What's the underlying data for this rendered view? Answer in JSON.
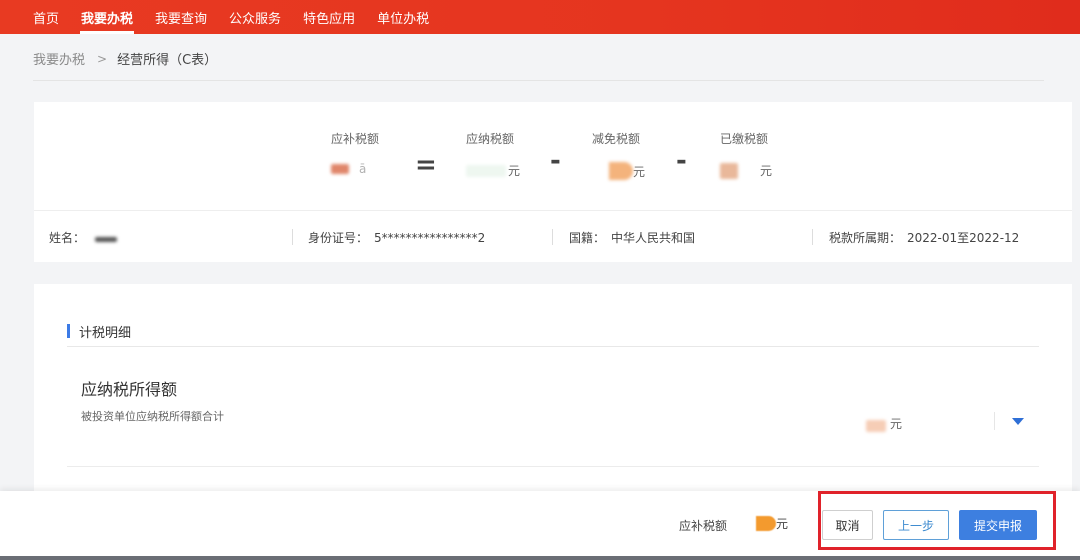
{
  "nav": {
    "items": [
      {
        "label": "首页",
        "active": false
      },
      {
        "label": "我要办税",
        "active": true
      },
      {
        "label": "我要查询",
        "active": false
      },
      {
        "label": "公众服务",
        "active": false
      },
      {
        "label": "特色应用",
        "active": false
      },
      {
        "label": "单位办税",
        "active": false
      }
    ]
  },
  "breadcrumb": {
    "parent": "我要办税",
    "separator": ">",
    "current": "经营所得（C表）"
  },
  "summary": {
    "payable": {
      "label": "应补税额",
      "unit": "ā"
    },
    "equals": "=",
    "due": {
      "label": "应纳税额",
      "unit": "元"
    },
    "minus1": "-",
    "reduced": {
      "label": "减免税额",
      "unit": "元"
    },
    "minus2": "-",
    "paid": {
      "label": "已缴税额",
      "unit": "元"
    }
  },
  "info": {
    "name_label": "姓名：",
    "id_label": "身份证号：",
    "id_value": "5****************2",
    "nation_label": "国籍：",
    "nation_value": "中华人民共和国",
    "period_label": "税款所属期：",
    "period_value": "2022-01至2022-12"
  },
  "detail": {
    "section_title": "计税明细",
    "item_title": "应纳税所得额",
    "item_subtitle": "被投资单位应纳税所得额合计",
    "item_unit": "元"
  },
  "bottom": {
    "payable_label": "应补税额",
    "payable_unit": "元",
    "cancel_label": "取消",
    "prev_label": "上一步",
    "submit_label": "提交申报"
  },
  "colors": {
    "brand_red": "#e5351f",
    "primary_blue": "#3d7fe0",
    "highlight_red": "#e0222a"
  }
}
